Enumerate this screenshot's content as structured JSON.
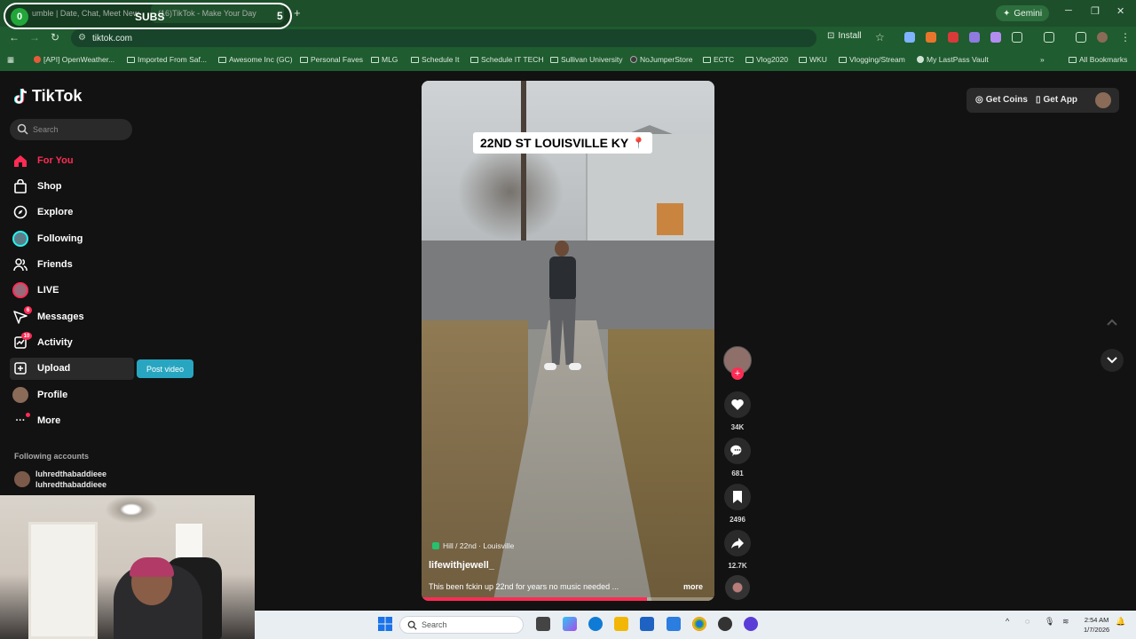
{
  "browser": {
    "tabs": [
      {
        "label": "umble | Date, Chat, Meet New"
      },
      {
        "label": "(16)TikTok - Make Your Day"
      }
    ],
    "sub_overlay": {
      "left_count": "0",
      "label": "SUBS",
      "right_count": "5"
    },
    "gemini_label": "Gemini",
    "url": "tiktok.com",
    "install_label": "Install",
    "bookmarks": [
      {
        "label": "[API] OpenWeather..."
      },
      {
        "label": "Imported From Saf..."
      },
      {
        "label": "Awesome Inc (GC)"
      },
      {
        "label": "Personal Faves"
      },
      {
        "label": "MLG"
      },
      {
        "label": "Schedule It"
      },
      {
        "label": "Schedule IT TECH"
      },
      {
        "label": "Sullivan University"
      },
      {
        "label": "NoJumperStore"
      },
      {
        "label": "ECTC"
      },
      {
        "label": "Vlog2020"
      },
      {
        "label": "WKU"
      },
      {
        "label": "Vlogging/Stream"
      },
      {
        "label": "My LastPass Vault"
      },
      {
        "label": "All Bookmarks"
      }
    ]
  },
  "tiktok": {
    "logo": "TikTok",
    "search_placeholder": "Search",
    "nav": [
      {
        "label": "For You"
      },
      {
        "label": "Shop"
      },
      {
        "label": "Explore"
      },
      {
        "label": "Following"
      },
      {
        "label": "Friends"
      },
      {
        "label": "LIVE"
      },
      {
        "label": "Messages"
      },
      {
        "label": "Activity"
      },
      {
        "label": "Upload"
      },
      {
        "label": "Profile"
      },
      {
        "label": "More"
      }
    ],
    "post_video": "Post video",
    "following_accounts_title": "Following accounts",
    "account_name_1": "luhredthabaddieee",
    "account_name_2": "luhredthabaddieee",
    "top_right": {
      "coins": "Get Coins",
      "app": "Get App"
    }
  },
  "video": {
    "caption": "22ND ST LOUISVILLE KY",
    "location": "Hill / 22nd · Louisville",
    "author": "lifewithjewell_",
    "description": "This       been fckin up 22nd for years       no music needed ...",
    "more": "more",
    "progress": 0.77
  },
  "actions": {
    "likes": "34K",
    "comments": "681",
    "saves": "2496",
    "shares": "12.7K"
  },
  "taskbar": {
    "search_placeholder": "Search",
    "time": "2:54 AM",
    "date": "1/7/2026"
  }
}
